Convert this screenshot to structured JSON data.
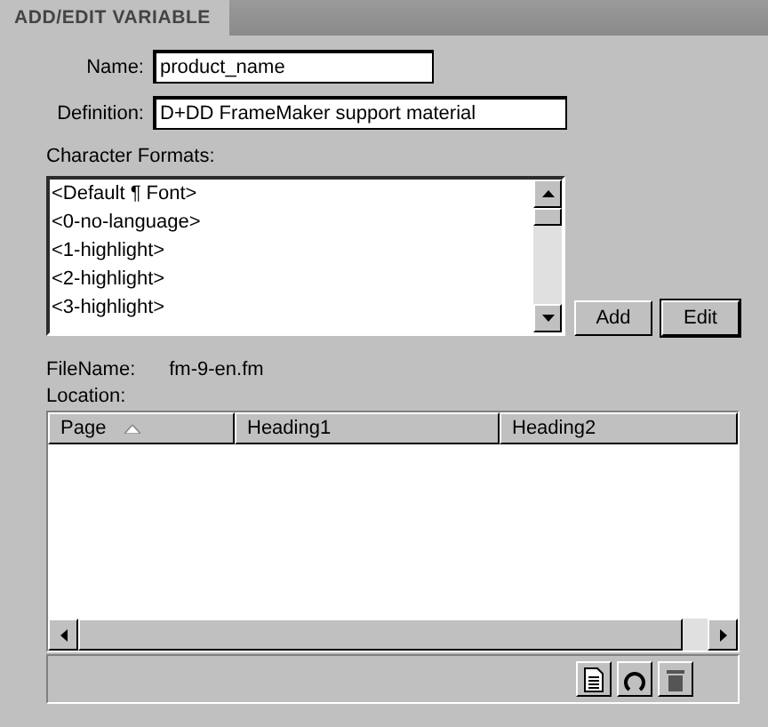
{
  "tab": {
    "title": "ADD/EDIT VARIABLE"
  },
  "name_field": {
    "label": "Name:",
    "value": "product_name"
  },
  "definition_field": {
    "label": "Definition:",
    "value": "D+DD FrameMaker support material"
  },
  "character_formats": {
    "label": "Character Formats:",
    "items": [
      {
        "text": "<Default ¶ Font>"
      },
      {
        "text": "<0-no-language>"
      },
      {
        "text": "<1-highlight>"
      },
      {
        "text": "<2-highlight>"
      },
      {
        "text": "<3-highlight>"
      }
    ]
  },
  "buttons": [
    {
      "label": "Add",
      "default": false
    },
    {
      "label": "Edit",
      "default": true
    }
  ],
  "file": {
    "label": "FileName:",
    "value": "fm-9-en.fm"
  },
  "location": {
    "label": "Location:",
    "columns": [
      {
        "label": "Page",
        "sorted": true
      },
      {
        "label": "Heading1",
        "sorted": false
      },
      {
        "label": "Heading2",
        "sorted": false
      }
    ]
  }
}
